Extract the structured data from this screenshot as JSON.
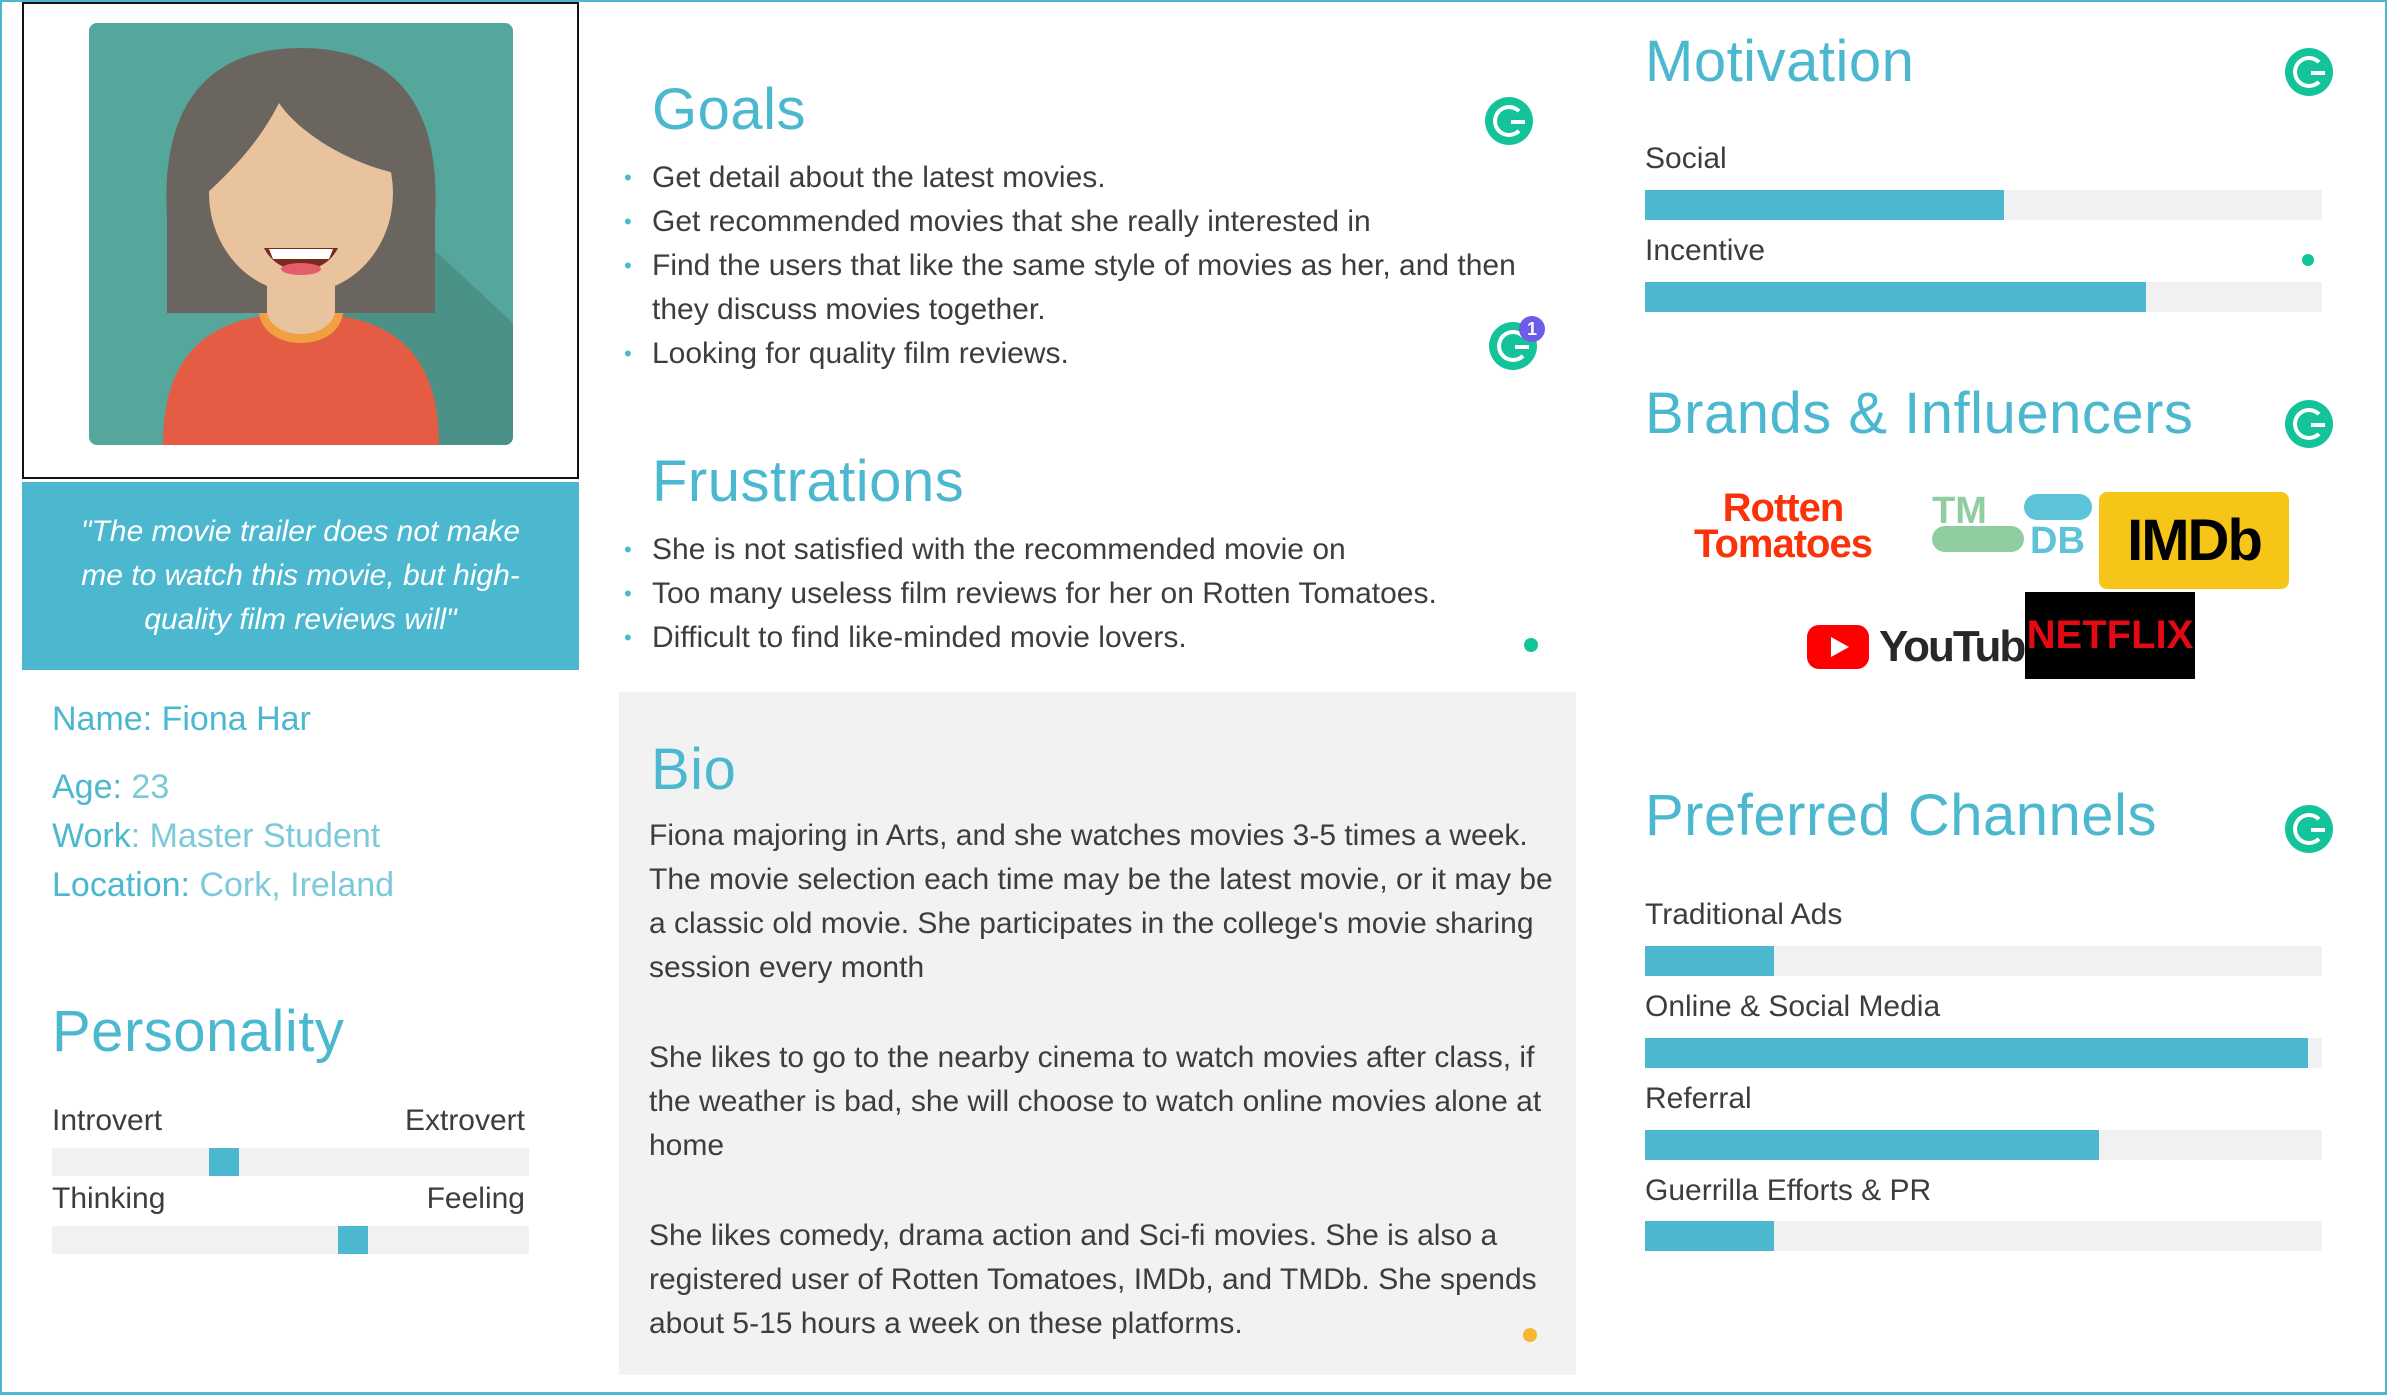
{
  "persona": {
    "quote": "\"The movie trailer does not make me to watch this movie, but high-quality film reviews will\"",
    "name_label": "Name:",
    "name_value": "Fiona Har",
    "age_label": "Age:",
    "age_value": "23",
    "work_label": "Work",
    "work_value": ": Master Student",
    "location_label": "Location:",
    "location_value": "Cork, Ireland"
  },
  "personality": {
    "title": "Personality",
    "scales": [
      {
        "left": "Introvert",
        "right": "Extrovert",
        "value": 0.36
      },
      {
        "left": "Thinking",
        "right": "Feeling",
        "value": 0.63
      }
    ]
  },
  "goals": {
    "title": "Goals",
    "items": [
      "Get detail about the latest movies.",
      "Get recommended movies that she really interested in",
      "Find the users that like the same style of movies as her, and then they discuss movies together.",
      "Looking for quality film reviews."
    ]
  },
  "frustrations": {
    "title": "Frustrations",
    "items": [
      "She is not satisfied with the recommended movie on",
      "Too many useless film reviews for her on Rotten Tomatoes.",
      "Difficult to find like-minded movie lovers."
    ]
  },
  "bio": {
    "title": "Bio",
    "paragraphs": [
      "Fiona majoring in Arts, and she watches movies 3-5 times a week. The movie selection each time may be the latest movie, or it may be a classic old movie. She participates in the college's movie sharing session every month",
      "She likes to go to the nearby cinema to watch movies after class, if the weather is bad, she will choose to watch online movies alone at home",
      "She likes comedy, drama action and Sci-fi movies. She is also a registered user of Rotten Tomatoes, IMDb, and TMDb. She spends about 5-15 hours a week on these platforms."
    ]
  },
  "motivation": {
    "title": "Motivation",
    "bars": [
      {
        "label": "Social",
        "value": 0.53
      },
      {
        "label": "Incentive",
        "value": 0.74
      }
    ]
  },
  "brands": {
    "title": "Brands & Influencers",
    "logos": {
      "rotten_tomatoes_1": "Rotten",
      "rotten_tomatoes_2": "Tomatoes",
      "tmdb_1": "TM",
      "tmdb_2": "DB",
      "imdb": "IMDb",
      "youtube": "YouTube",
      "netflix": "NETFLIX"
    }
  },
  "channels": {
    "title": "Preferred Channels",
    "bars": [
      {
        "label": "Traditional Ads",
        "value": 0.19
      },
      {
        "label": "Online & Social Media",
        "value": 0.98
      },
      {
        "label": "Referral",
        "value": 0.67
      },
      {
        "label": "Guerrilla Efforts & PR",
        "value": 0.19
      }
    ]
  },
  "badges": {
    "grammarly_count": "1"
  },
  "colors": {
    "accent": "#4cb8d0",
    "avatar_bg": "#55a79c",
    "grammarly": "#15c39a"
  }
}
